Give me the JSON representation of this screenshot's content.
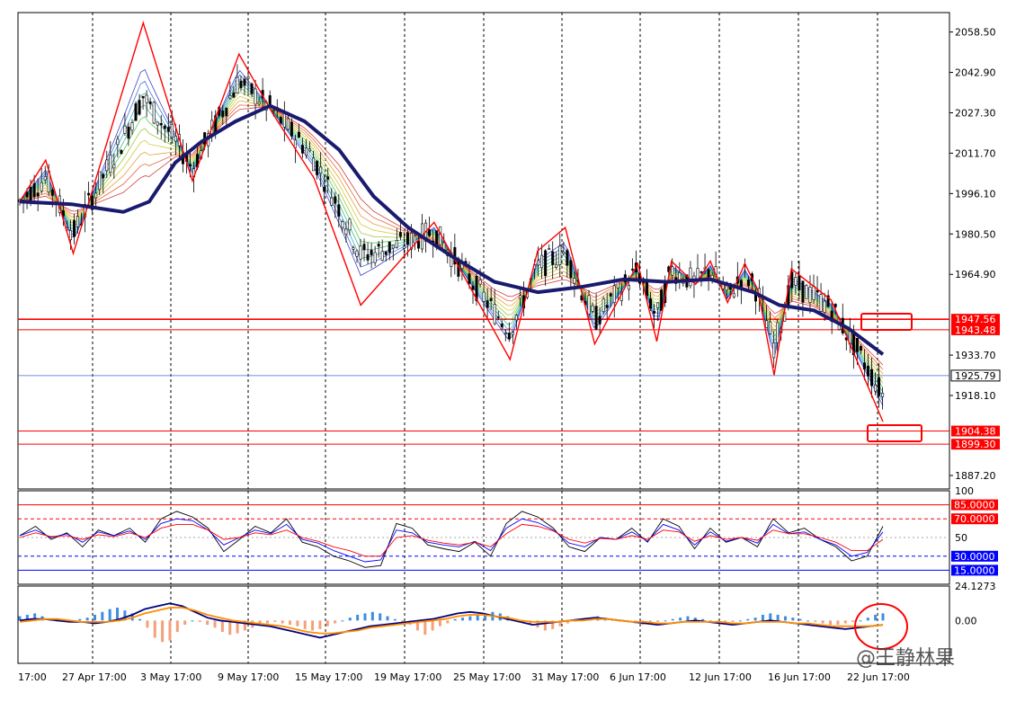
{
  "watermark": "@王静林果",
  "chart_data": [
    {
      "type": "candlestick",
      "panel": "price",
      "ylim": [
        1882,
        2066
      ],
      "y_ticks": [
        "2058.50",
        "2042.90",
        "2027.30",
        "2011.70",
        "1996.10",
        "1980.50",
        "1964.90",
        "1933.70",
        "1918.10",
        "1887.20"
      ],
      "x_ticks": [
        "17:00",
        "27 Apr 17:00",
        "3 May 17:00",
        "9 May 17:00",
        "15 May 17:00",
        "19 May 17:00",
        "25 May 17:00",
        "31 May 17:00",
        "6 Jun 17:00",
        "12 Jun 17:00",
        "16 Jun 17:00",
        "22 Jun 17:00"
      ],
      "current_price": {
        "value": 1925.79,
        "label": "1925.79"
      },
      "horizontal_levels": [
        {
          "value": 1947.56,
          "label": "1947.56",
          "color": "#ff0000"
        },
        {
          "value": 1943.48,
          "label": "1943.48",
          "color": "#ff0000"
        },
        {
          "value": 1904.38,
          "label": "1904.38",
          "color": "#ff0000"
        },
        {
          "value": 1899.3,
          "label": "1899.30",
          "color": "#ff0000"
        }
      ],
      "zigzag": [
        {
          "x": 0,
          "y": 1993
        },
        {
          "x": 0.03,
          "y": 2009
        },
        {
          "x": 0.062,
          "y": 1973
        },
        {
          "x": 0.143,
          "y": 2062
        },
        {
          "x": 0.2,
          "y": 2001
        },
        {
          "x": 0.254,
          "y": 2050
        },
        {
          "x": 0.293,
          "y": 2027
        },
        {
          "x": 0.341,
          "y": 2002
        },
        {
          "x": 0.395,
          "y": 1953
        },
        {
          "x": 0.48,
          "y": 1985
        },
        {
          "x": 0.568,
          "y": 1932
        },
        {
          "x": 0.6,
          "y": 1974
        },
        {
          "x": 0.632,
          "y": 1983
        },
        {
          "x": 0.666,
          "y": 1938
        },
        {
          "x": 0.716,
          "y": 1969
        },
        {
          "x": 0.738,
          "y": 1939
        },
        {
          "x": 0.755,
          "y": 1970
        },
        {
          "x": 0.783,
          "y": 1961
        },
        {
          "x": 0.8,
          "y": 1970
        },
        {
          "x": 0.82,
          "y": 1954
        },
        {
          "x": 0.84,
          "y": 1969
        },
        {
          "x": 0.855,
          "y": 1959
        },
        {
          "x": 0.874,
          "y": 1926
        },
        {
          "x": 0.894,
          "y": 1967
        },
        {
          "x": 0.94,
          "y": 1955
        },
        {
          "x": 1.0,
          "y": 1908
        }
      ],
      "moving_average": [
        {
          "x": 0,
          "y": 1993
        },
        {
          "x": 0.06,
          "y": 1992
        },
        {
          "x": 0.12,
          "y": 1989
        },
        {
          "x": 0.15,
          "y": 1993
        },
        {
          "x": 0.18,
          "y": 2008
        },
        {
          "x": 0.21,
          "y": 2016
        },
        {
          "x": 0.25,
          "y": 2024
        },
        {
          "x": 0.29,
          "y": 2030
        },
        {
          "x": 0.33,
          "y": 2024
        },
        {
          "x": 0.37,
          "y": 2013
        },
        {
          "x": 0.41,
          "y": 1995
        },
        {
          "x": 0.45,
          "y": 1983
        },
        {
          "x": 0.5,
          "y": 1972
        },
        {
          "x": 0.55,
          "y": 1962
        },
        {
          "x": 0.6,
          "y": 1958
        },
        {
          "x": 0.65,
          "y": 1960
        },
        {
          "x": 0.7,
          "y": 1963
        },
        {
          "x": 0.75,
          "y": 1962
        },
        {
          "x": 0.8,
          "y": 1963
        },
        {
          "x": 0.85,
          "y": 1958
        },
        {
          "x": 0.88,
          "y": 1953
        },
        {
          "x": 0.92,
          "y": 1951
        },
        {
          "x": 0.96,
          "y": 1944
        },
        {
          "x": 1.0,
          "y": 1934
        }
      ]
    },
    {
      "type": "line",
      "panel": "oscillator",
      "ylim": [
        0,
        100
      ],
      "y_ticks": [
        "100",
        "50"
      ],
      "levels": [
        {
          "value": 85,
          "label": "85.0000",
          "color": "#ff0000",
          "style": "solid"
        },
        {
          "value": 70,
          "label": "70.0000",
          "color": "#ff0000",
          "style": "dash"
        },
        {
          "value": 30,
          "label": "30.0000",
          "color": "#0000ff",
          "style": "dash"
        },
        {
          "value": 15,
          "label": "15.0000",
          "color": "#0000ff",
          "style": "solid"
        }
      ],
      "series": [
        {
          "color": "#000000",
          "values": [
            52,
            62,
            48,
            55,
            40,
            58,
            52,
            60,
            45,
            70,
            78,
            72,
            60,
            35,
            48,
            62,
            55,
            70,
            45,
            40,
            30,
            25,
            18,
            20,
            65,
            60,
            42,
            38,
            35,
            45,
            30,
            65,
            78,
            72,
            60,
            40,
            35,
            50,
            48,
            60,
            45,
            70,
            62,
            38,
            60,
            45,
            50,
            40,
            70,
            55,
            60,
            48,
            40,
            25,
            30,
            62
          ]
        },
        {
          "color": "#0000ff",
          "values": [
            52,
            58,
            50,
            54,
            45,
            56,
            52,
            57,
            48,
            65,
            70,
            68,
            58,
            42,
            50,
            58,
            54,
            64,
            48,
            44,
            36,
            30,
            24,
            26,
            58,
            55,
            45,
            42,
            40,
            46,
            36,
            60,
            70,
            66,
            58,
            44,
            40,
            50,
            48,
            56,
            46,
            64,
            58,
            42,
            56,
            46,
            50,
            44,
            64,
            54,
            56,
            48,
            42,
            30,
            34,
            56
          ]
        },
        {
          "color": "#ff0000",
          "values": [
            50,
            55,
            51,
            52,
            48,
            53,
            51,
            55,
            50,
            60,
            64,
            64,
            58,
            48,
            50,
            55,
            53,
            58,
            50,
            46,
            40,
            36,
            30,
            30,
            50,
            52,
            47,
            44,
            42,
            45,
            40,
            54,
            64,
            62,
            57,
            48,
            44,
            49,
            48,
            52,
            48,
            58,
            56,
            46,
            52,
            48,
            50,
            47,
            58,
            54,
            54,
            50,
            45,
            36,
            36,
            48
          ]
        }
      ]
    },
    {
      "type": "bar",
      "panel": "macd",
      "y_ticks": [
        "24.1273",
        "0.00"
      ],
      "ylim": [
        -30,
        24.1273
      ],
      "histogram": [
        3,
        4,
        5,
        3,
        1,
        0,
        -1,
        0,
        1,
        2,
        4,
        6,
        8,
        9,
        7,
        5,
        1,
        -5,
        -12,
        -15,
        -14,
        -8,
        -3,
        0,
        -1,
        -3,
        -5,
        -8,
        -10,
        -9,
        -7,
        -5,
        -3,
        -2,
        -1,
        -2,
        -3,
        -4,
        -6,
        -7,
        -6,
        -4,
        -2,
        0,
        2,
        4,
        5,
        6,
        5,
        3,
        1,
        -1,
        -3,
        -7,
        -10,
        -7,
        -4,
        -2,
        1,
        2,
        3,
        4,
        5,
        6,
        5,
        3,
        1,
        -1,
        -3,
        -5,
        -7,
        -6,
        -4,
        -2,
        0,
        1,
        2,
        3,
        2,
        1,
        0,
        -1,
        -2,
        -3,
        -2,
        -1,
        0,
        1,
        2,
        3,
        2,
        1,
        0,
        -1,
        -2,
        -1,
        0,
        1,
        2,
        4,
        5,
        4,
        3,
        2,
        1,
        0,
        -1,
        -2,
        -3,
        -3,
        -2,
        -1,
        0,
        2,
        4,
        5
      ],
      "series": [
        {
          "name": "",
          "color": "#000080",
          "values": [
            0,
            1,
            1,
            0,
            -1,
            -1,
            -2,
            -1,
            1,
            4,
            8,
            10,
            12,
            10,
            6,
            2,
            0,
            -1,
            -2,
            -3,
            -4,
            -6,
            -8,
            -10,
            -12,
            -10,
            -8,
            -6,
            -4,
            -3,
            -2,
            -1,
            0,
            1,
            3,
            5,
            6,
            5,
            3,
            1,
            -1,
            -3,
            -2,
            -1,
            0,
            1,
            2,
            1,
            0,
            -1,
            -2,
            -3,
            -2,
            -1,
            0,
            -1,
            -2,
            -3,
            -2,
            -1,
            0,
            -1,
            -2,
            -3,
            -4,
            -5,
            -6,
            -5,
            -4,
            -3
          ]
        },
        {
          "name": "",
          "color": "#ff8c00",
          "values": [
            -1,
            0,
            1,
            1,
            0,
            -1,
            -1,
            -1,
            0,
            2,
            5,
            7,
            9,
            9,
            7,
            4,
            2,
            0,
            -1,
            -2,
            -3,
            -4,
            -6,
            -8,
            -9,
            -9,
            -8,
            -7,
            -5,
            -4,
            -3,
            -2,
            -1,
            0,
            1,
            3,
            4,
            4,
            3,
            2,
            0,
            -1,
            -1,
            -1,
            0,
            0,
            1,
            1,
            0,
            -1,
            -1,
            -2,
            -2,
            -1,
            -1,
            -1,
            -1,
            -2,
            -2,
            -1,
            -1,
            -1,
            -2,
            -2,
            -3,
            -4,
            -4,
            -4,
            -4,
            -3
          ]
        }
      ]
    }
  ]
}
